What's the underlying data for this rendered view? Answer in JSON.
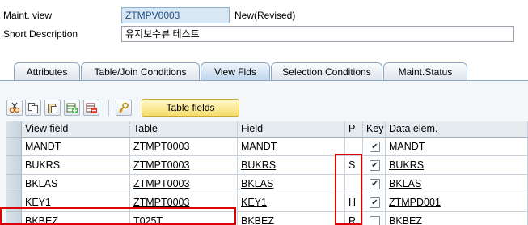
{
  "header": {
    "maint_view_label": "Maint. view",
    "maint_view_value": "ZTMPV0003",
    "status": "New(Revised)",
    "short_desc_label": "Short Description",
    "short_desc_value": "유지보수뷰 테스트"
  },
  "tabs": [
    {
      "label": "Attributes",
      "active": false
    },
    {
      "label": "Table/Join Conditions",
      "active": false
    },
    {
      "label": "View Flds",
      "active": true
    },
    {
      "label": "Selection Conditions",
      "active": false
    },
    {
      "label": "Maint.Status",
      "active": false
    }
  ],
  "toolbar": {
    "icons": [
      "cut-icon",
      "copy-icon",
      "paste-icon",
      "insert-row-icon",
      "delete-row-icon",
      "key-icon"
    ],
    "table_fields_label": "Table fields"
  },
  "grid": {
    "columns": [
      "View field",
      "Table",
      "Field",
      "P",
      "Key",
      "Data elem."
    ],
    "rows": [
      {
        "view_field": "MANDT",
        "table": "ZTMPT0003",
        "field": "MANDT",
        "p": "",
        "key": true,
        "data_elem": "MANDT"
      },
      {
        "view_field": "BUKRS",
        "table": "ZTMPT0003",
        "field": "BUKRS",
        "p": "S",
        "key": true,
        "data_elem": "BUKRS"
      },
      {
        "view_field": "BKLAS",
        "table": "ZTMPT0003",
        "field": "BKLAS",
        "p": "",
        "key": true,
        "data_elem": "BKLAS"
      },
      {
        "view_field": "KEY1",
        "table": "ZTMPT0003",
        "field": "KEY1",
        "p": "H",
        "key": true,
        "data_elem": "ZTMPD001"
      },
      {
        "view_field": "BKBEZ",
        "table": "T025T",
        "field": "BKBEZ",
        "p": "R",
        "key": false,
        "data_elem": "BKBEZ"
      }
    ]
  },
  "colors": {
    "highlight_box": "#e00000",
    "table_fields_button": "#f5dd6a"
  }
}
